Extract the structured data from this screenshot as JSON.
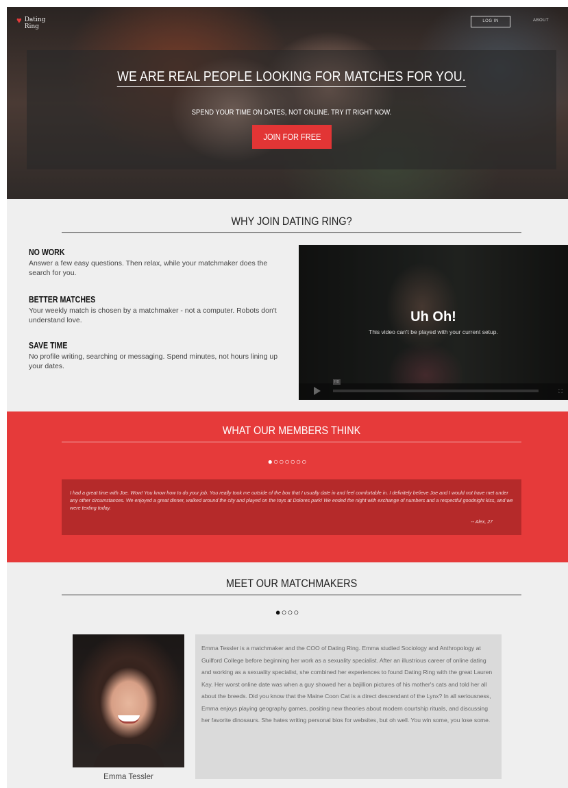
{
  "header": {
    "logo_text": "Dating Ring",
    "login_label": "LOG IN",
    "about_label": "ABOUT"
  },
  "hero": {
    "title": "WE ARE REAL PEOPLE LOOKING FOR MATCHES FOR YOU.",
    "subtitle": "SPEND YOUR TIME ON DATES, NOT ONLINE. TRY IT RIGHT NOW.",
    "cta_label": "JOIN FOR FREE"
  },
  "why": {
    "title": "WHY JOIN DATING RING?",
    "features": [
      {
        "heading": "NO WORK",
        "text": "Answer a few easy questions. Then relax, while your matchmaker does the search for you."
      },
      {
        "heading": "BETTER MATCHES",
        "text": "Your weekly match is chosen by a matchmaker - not a computer. Robots don't understand love."
      },
      {
        "heading": "SAVE TIME",
        "text": "No profile writing, searching or messaging. Spend minutes, not hours lining up your dates."
      }
    ],
    "video": {
      "message": "Uh Oh!",
      "sub": "This video can't be played with your current setup.",
      "hd": "HD"
    }
  },
  "members": {
    "title": "WHAT OUR MEMBERS THINK",
    "dots": "●○○○○○○",
    "quote": "I had a great time with Joe. Wow! You know how to do your job. You really took me outside of the box that I usually date in and feel comfortable in. I definitely believe Joe and I would not have met under any other circumstances. We enjoyed a great dinner, walked around the city and played on the toys at Dolores park! We ended the night with exchange of numbers and a respectful goodnight kiss, and we were texting today.",
    "author": "-- Alex, 27"
  },
  "matchmakers": {
    "title": "MEET OUR MATCHMAKERS",
    "dots": "●○○○",
    "name": "Emma Tessler",
    "bio": "Emma Tessler is a matchmaker and the COO of Dating Ring. Emma studied Sociology and Anthropology at Guilford College before beginning her work as a sexuality specialist. After an illustrious career of online dating and working as a sexuality specialist, she combined her experiences to found Dating Ring with the great Lauren Kay. Her worst online date was when a guy showed her a bajillion pictures of his mother's cats and told her all about the breeds. Did you know that the Maine Coon Cat is a direct descendant of the Lynx? In all seriousness, Emma enjoys playing geography games, positing new theories about modern courtship rituals, and discussing her favorite dinosaurs. She hates writing personal bios for websites, but oh well. You win some, you lose some."
  },
  "colors": {
    "accent": "#e63a3a",
    "accent_dark": "#b52a2a",
    "background": "#efefef"
  }
}
